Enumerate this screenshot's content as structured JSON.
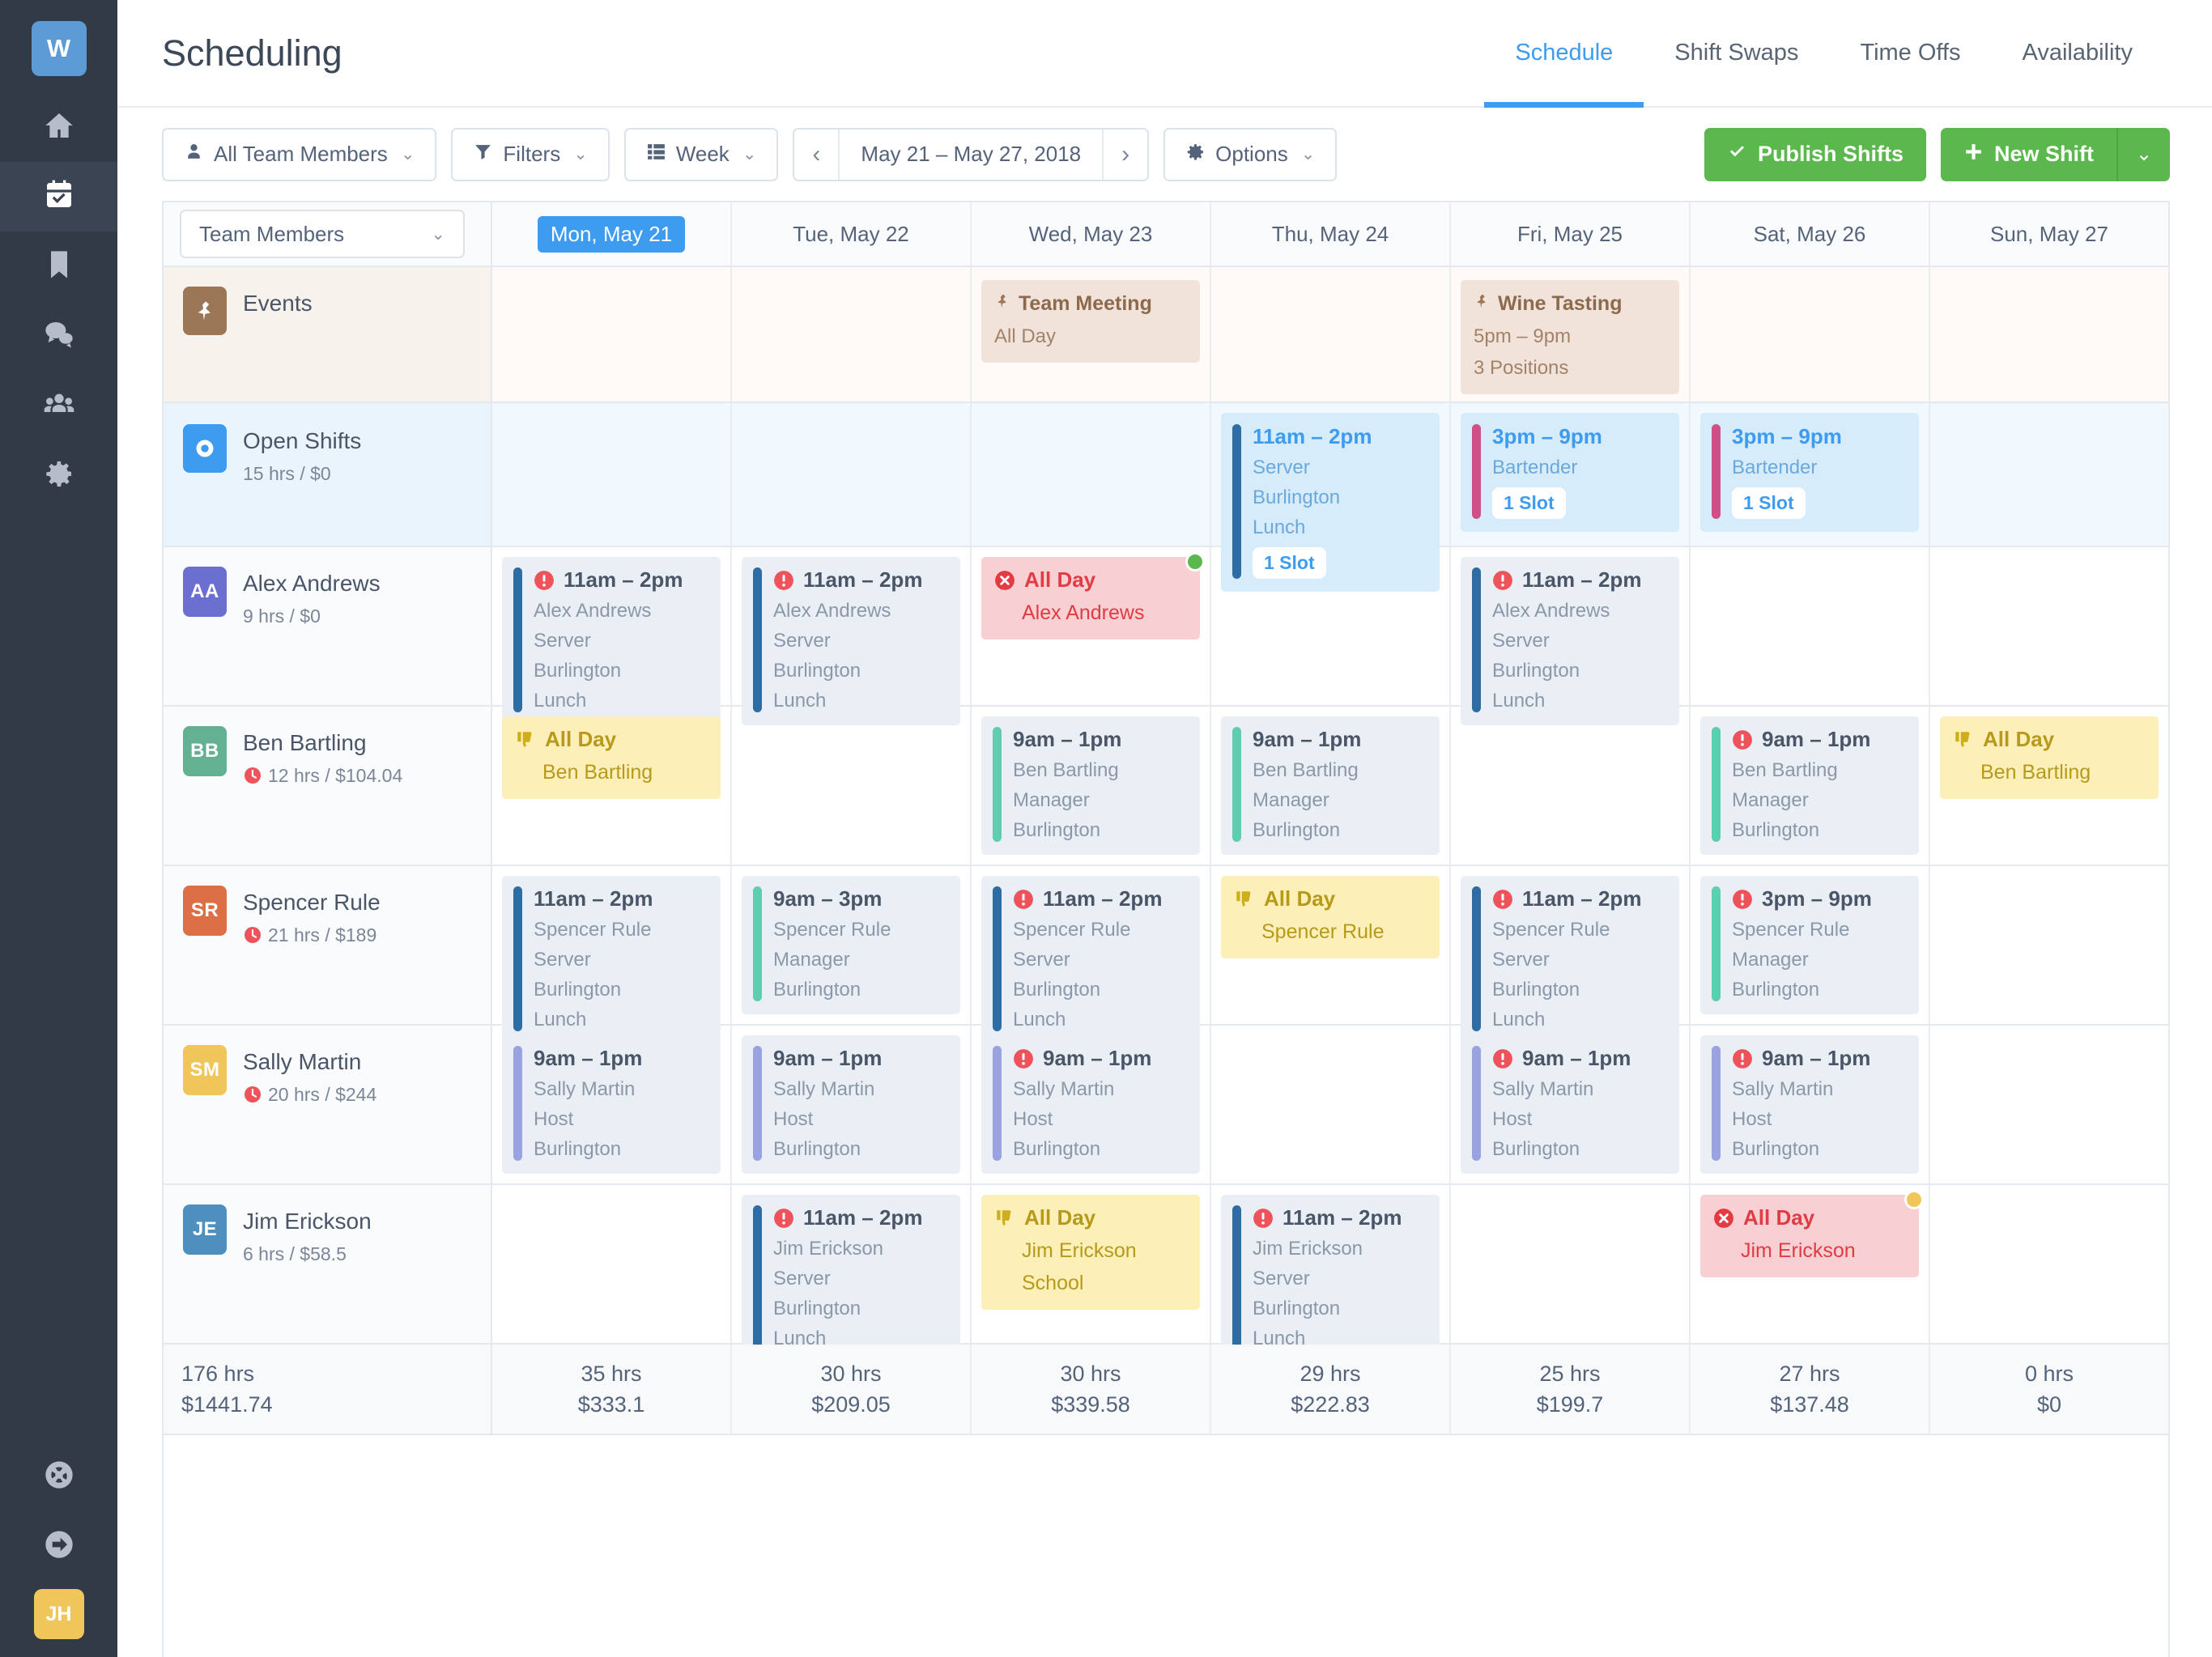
{
  "header": {
    "title": "Scheduling",
    "logo_initials": "W",
    "tabs": [
      {
        "label": "Schedule",
        "active": true
      },
      {
        "label": "Shift Swaps",
        "active": false
      },
      {
        "label": "Time Offs",
        "active": false
      },
      {
        "label": "Availability",
        "active": false
      }
    ],
    "accent_color": "#3d9bf0"
  },
  "rail": {
    "items": [
      {
        "icon": "home-icon",
        "active": false
      },
      {
        "icon": "calendar-check-icon",
        "active": true
      },
      {
        "icon": "bookmark-icon",
        "active": false
      },
      {
        "icon": "chat-bubbles-icon",
        "active": false
      },
      {
        "icon": "people-icon",
        "active": false
      },
      {
        "icon": "gear-icon",
        "active": false
      }
    ],
    "bottom": [
      {
        "icon": "lifering-icon"
      },
      {
        "icon": "arrow-right-circle-icon"
      }
    ],
    "user_initials": "JH",
    "user_avatar_color": "#f0c65b"
  },
  "toolbar": {
    "team_filter": "All Team Members",
    "filters": "Filters",
    "view": "Week",
    "date_range": "May 21 – May 27, 2018",
    "prev": "‹",
    "next": "›",
    "options": "Options",
    "publish": "Publish Shifts",
    "new_shift": "New Shift",
    "green_color": "#5bb84c"
  },
  "grid": {
    "member_select": "Team Members",
    "days": [
      {
        "label": "Mon, May 21",
        "today": true
      },
      {
        "label": "Tue, May 22",
        "today": false
      },
      {
        "label": "Wed, May 23",
        "today": false
      },
      {
        "label": "Thu, May 24",
        "today": false
      },
      {
        "label": "Fri, May 25",
        "today": false
      },
      {
        "label": "Sat, May 26",
        "today": false
      },
      {
        "label": "Sun, May 27",
        "today": false
      }
    ],
    "events_row": {
      "title": "Events",
      "icon": "pin-icon",
      "cells": [
        null,
        null,
        {
          "title": "Team Meeting",
          "lines": [
            "All Day"
          ]
        },
        null,
        {
          "title": "Wine Tasting",
          "lines": [
            "5pm – 9pm",
            "3 Positions"
          ]
        },
        null,
        null
      ]
    },
    "open_shifts_row": {
      "title": "Open Shifts",
      "sub": "15 hrs / $0",
      "icon": "record-icon",
      "cells": [
        null,
        null,
        null,
        {
          "time": "11am – 2pm",
          "lines": [
            "Server",
            "Burlington",
            "Lunch"
          ],
          "slot": "1 Slot",
          "bar_color": "#2e6da4"
        },
        {
          "time": "3pm – 9pm",
          "lines": [
            "Bartender"
          ],
          "slot": "1 Slot",
          "bar_color": "#cf4f86"
        },
        {
          "time": "3pm – 9pm",
          "lines": [
            "Bartender"
          ],
          "slot": "1 Slot",
          "bar_color": "#cf4f86"
        },
        null
      ]
    },
    "members": [
      {
        "initials": "AA",
        "name": "Alex Andrews",
        "sub": "9 hrs / $0",
        "has_clock": false,
        "avatar_color": "#6b6fd0",
        "cells": [
          {
            "type": "shift",
            "time": "11am – 2pm",
            "alert": true,
            "lines": [
              "Alex Andrews",
              "Server",
              "Burlington",
              "Lunch"
            ],
            "bar_color": "#2e6da4"
          },
          {
            "type": "shift",
            "time": "11am – 2pm",
            "alert": true,
            "lines": [
              "Alex Andrews",
              "Server",
              "Burlington",
              "Lunch"
            ],
            "bar_color": "#2e6da4"
          },
          {
            "type": "timeoff",
            "style": "red",
            "title": "All Day",
            "sub": "Alex Andrews",
            "icon": "x-circle-icon",
            "dot_color": "#5bb84c"
          },
          null,
          {
            "type": "shift",
            "time": "11am – 2pm",
            "alert": true,
            "lines": [
              "Alex Andrews",
              "Server",
              "Burlington",
              "Lunch"
            ],
            "bar_color": "#2e6da4"
          },
          null,
          null
        ]
      },
      {
        "initials": "BB",
        "name": "Ben Bartling",
        "sub": "12 hrs / $104.04",
        "has_clock": true,
        "avatar_color": "#63b093",
        "cells": [
          {
            "type": "timeoff",
            "style": "yellow",
            "title": "All Day",
            "sub": "Ben Bartling",
            "icon": "thumbs-down-icon"
          },
          null,
          {
            "type": "shift",
            "time": "9am – 1pm",
            "alert": false,
            "lines": [
              "Ben Bartling",
              "Manager",
              "Burlington"
            ],
            "bar_color": "#5ecfae"
          },
          {
            "type": "shift",
            "time": "9am – 1pm",
            "alert": false,
            "lines": [
              "Ben Bartling",
              "Manager",
              "Burlington"
            ],
            "bar_color": "#5ecfae"
          },
          null,
          {
            "type": "shift",
            "time": "9am – 1pm",
            "alert": true,
            "lines": [
              "Ben Bartling",
              "Manager",
              "Burlington"
            ],
            "bar_color": "#5ecfae"
          },
          {
            "type": "timeoff",
            "style": "yellow",
            "title": "All Day",
            "sub": "Ben Bartling",
            "icon": "thumbs-down-icon"
          }
        ]
      },
      {
        "initials": "SR",
        "name": "Spencer Rule",
        "sub": "21 hrs / $189",
        "has_clock": true,
        "avatar_color": "#dd6f47",
        "cells": [
          {
            "type": "shift",
            "time": "11am – 2pm",
            "alert": false,
            "lines": [
              "Spencer Rule",
              "Server",
              "Burlington",
              "Lunch"
            ],
            "bar_color": "#2e6da4"
          },
          {
            "type": "shift",
            "time": "9am – 3pm",
            "alert": false,
            "lines": [
              "Spencer Rule",
              "Manager",
              "Burlington"
            ],
            "bar_color": "#5ecfae"
          },
          {
            "type": "shift",
            "time": "11am – 2pm",
            "alert": true,
            "lines": [
              "Spencer Rule",
              "Server",
              "Burlington",
              "Lunch"
            ],
            "bar_color": "#2e6da4"
          },
          {
            "type": "timeoff",
            "style": "yellow",
            "title": "All Day",
            "sub": "Spencer Rule",
            "icon": "thumbs-down-icon"
          },
          {
            "type": "shift",
            "time": "11am – 2pm",
            "alert": true,
            "lines": [
              "Spencer Rule",
              "Server",
              "Burlington",
              "Lunch"
            ],
            "bar_color": "#2e6da4"
          },
          {
            "type": "shift",
            "time": "3pm – 9pm",
            "alert": true,
            "lines": [
              "Spencer Rule",
              "Manager",
              "Burlington"
            ],
            "bar_color": "#5ecfae"
          },
          null
        ]
      },
      {
        "initials": "SM",
        "name": "Sally Martin",
        "sub": "20 hrs / $244",
        "has_clock": true,
        "avatar_color": "#f0c65b",
        "cells": [
          {
            "type": "shift",
            "time": "9am – 1pm",
            "alert": false,
            "lines": [
              "Sally Martin",
              "Host",
              "Burlington"
            ],
            "bar_color": "#9aa3e0"
          },
          {
            "type": "shift",
            "time": "9am – 1pm",
            "alert": false,
            "lines": [
              "Sally Martin",
              "Host",
              "Burlington"
            ],
            "bar_color": "#9aa3e0"
          },
          {
            "type": "shift",
            "time": "9am – 1pm",
            "alert": true,
            "lines": [
              "Sally Martin",
              "Host",
              "Burlington"
            ],
            "bar_color": "#9aa3e0"
          },
          null,
          {
            "type": "shift",
            "time": "9am – 1pm",
            "alert": true,
            "lines": [
              "Sally Martin",
              "Host",
              "Burlington"
            ],
            "bar_color": "#9aa3e0"
          },
          {
            "type": "shift",
            "time": "9am – 1pm",
            "alert": true,
            "lines": [
              "Sally Martin",
              "Host",
              "Burlington"
            ],
            "bar_color": "#9aa3e0"
          },
          null
        ]
      },
      {
        "initials": "JE",
        "name": "Jim Erickson",
        "sub": "6 hrs / $58.5",
        "has_clock": false,
        "avatar_color": "#4f8fc0",
        "cells": [
          null,
          {
            "type": "shift",
            "time": "11am – 2pm",
            "alert": true,
            "lines": [
              "Jim Erickson",
              "Server",
              "Burlington",
              "Lunch"
            ],
            "bar_color": "#2e6da4"
          },
          {
            "type": "timeoff",
            "style": "yellow",
            "title": "All Day",
            "sub": "Jim Erickson",
            "extra": "School",
            "icon": "thumbs-down-icon"
          },
          {
            "type": "shift",
            "time": "11am – 2pm",
            "alert": true,
            "lines": [
              "Jim Erickson",
              "Server",
              "Burlington",
              "Lunch"
            ],
            "bar_color": "#2e6da4"
          },
          null,
          {
            "type": "timeoff",
            "style": "red",
            "title": "All Day",
            "sub": "Jim Erickson",
            "icon": "x-circle-icon",
            "dot_color": "#f0c65b"
          },
          null
        ]
      }
    ],
    "totals": {
      "grand_hours": "176 hrs",
      "grand_amount": "$1441.74",
      "days": [
        {
          "hours": "35 hrs",
          "amount": "$333.1"
        },
        {
          "hours": "30 hrs",
          "amount": "$209.05"
        },
        {
          "hours": "30 hrs",
          "amount": "$339.58"
        },
        {
          "hours": "29 hrs",
          "amount": "$222.83"
        },
        {
          "hours": "25 hrs",
          "amount": "$199.7"
        },
        {
          "hours": "27 hrs",
          "amount": "$137.48"
        },
        {
          "hours": "0 hrs",
          "amount": "$0"
        }
      ]
    }
  }
}
